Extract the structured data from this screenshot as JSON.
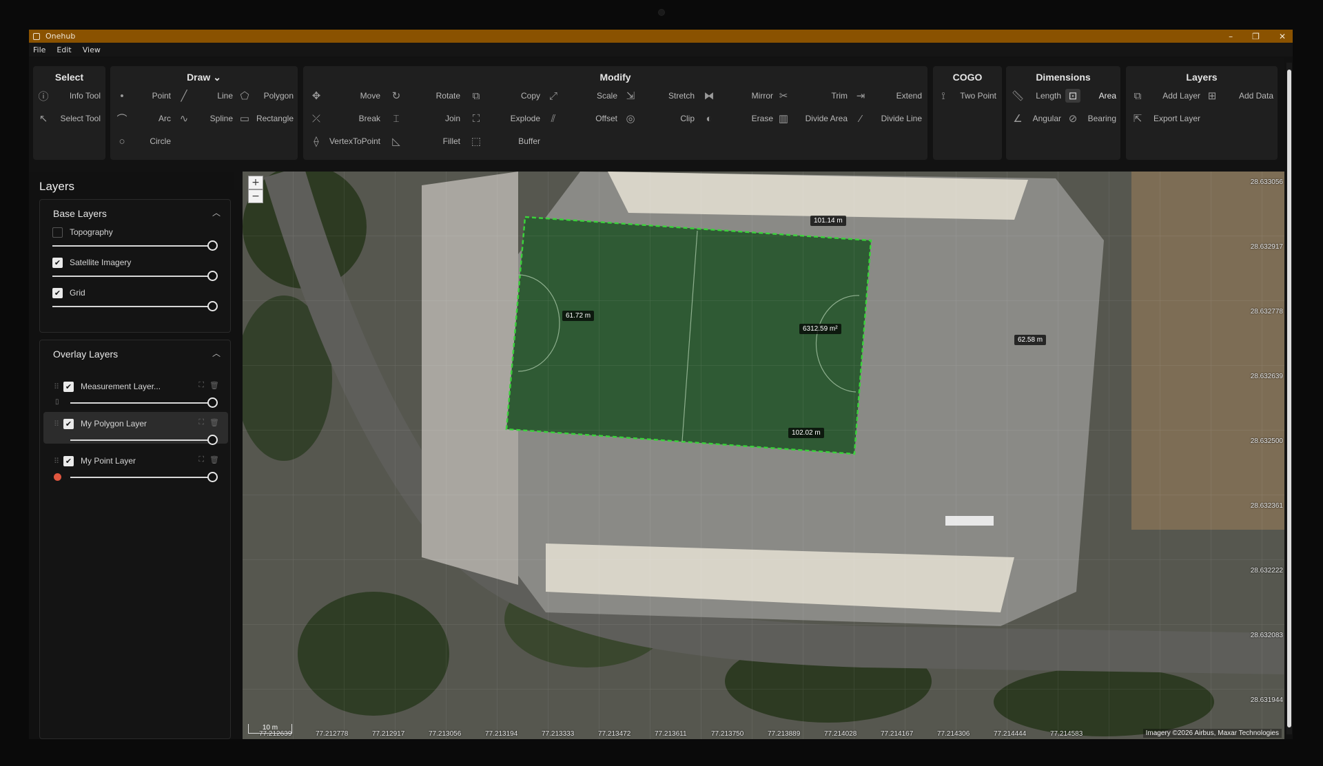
{
  "window": {
    "title": "Onehub",
    "controls": [
      "–",
      "❐",
      "✕"
    ]
  },
  "menu": [
    "File",
    "Edit",
    "View"
  ],
  "ribbon": {
    "select": {
      "title": "Select",
      "tools": [
        "Info Tool",
        "Select Tool"
      ]
    },
    "draw": {
      "title": "Draw",
      "chevron": "⌄",
      "tools": [
        "Point",
        "Line",
        "Polygon",
        "Arc",
        "Spline",
        "Rectangle",
        "Circle"
      ]
    },
    "modify": {
      "title": "Modify",
      "tools": [
        "Move",
        "Rotate",
        "Copy",
        "Scale",
        "Stretch",
        "Mirror",
        "Trim",
        "Extend",
        "Break",
        "Join",
        "Explode",
        "Offset",
        "Clip",
        "Erase",
        "Divide Area",
        "Divide Line",
        "VertexToPoint",
        "Fillet",
        "Buffer"
      ]
    },
    "cogo": {
      "title": "COGO",
      "tools": [
        "Two Point"
      ]
    },
    "dimensions": {
      "title": "Dimensions",
      "tools": [
        "Length",
        "Area",
        "Angular",
        "Bearing"
      ],
      "active": "Area"
    },
    "layers": {
      "title": "Layers",
      "tools": [
        "Add Layer",
        "Add Data",
        "Export Layer"
      ]
    }
  },
  "sidebar": {
    "title": "Layers",
    "base": {
      "title": "Base Layers",
      "items": [
        {
          "label": "Topography",
          "checked": false,
          "opacity": 1.0
        },
        {
          "label": "Satellite Imagery",
          "checked": true,
          "opacity": 1.0
        },
        {
          "label": "Grid",
          "checked": true,
          "opacity": 1.0
        }
      ]
    },
    "overlay": {
      "title": "Overlay Layers",
      "items": [
        {
          "label": "Measurement Layer...",
          "checked": true,
          "opacity": 1.0
        },
        {
          "label": "My Polygon Layer",
          "checked": true,
          "opacity": 1.0,
          "selected": true
        },
        {
          "label": "My Point Layer",
          "checked": true,
          "opacity": 1.0
        }
      ]
    }
  },
  "map": {
    "zoom_in": "+",
    "zoom_out": "−",
    "measurements": {
      "top": "101.14 m",
      "left": "61.72 m",
      "right": "62.58 m",
      "bottom": "102.02 m",
      "area": "6312.59 m²"
    },
    "lat_ticks": [
      "28.633056",
      "28.632917",
      "28.632778",
      "28.632639",
      "28.632500",
      "28.632361",
      "28.632222",
      "28.632083",
      "28.631944"
    ],
    "lon_ticks": [
      "77.212639",
      "77.212778",
      "77.212917",
      "77.213056",
      "77.213194",
      "77.213333",
      "77.213472",
      "77.213611",
      "77.213750",
      "77.213889",
      "77.214028",
      "77.214167",
      "77.214306",
      "77.214444",
      "77.214583"
    ],
    "scale": "10 m",
    "attribution": "Imagery ©2026 Airbus, Maxar Technologies",
    "polygon_color": "#3bd13b"
  }
}
